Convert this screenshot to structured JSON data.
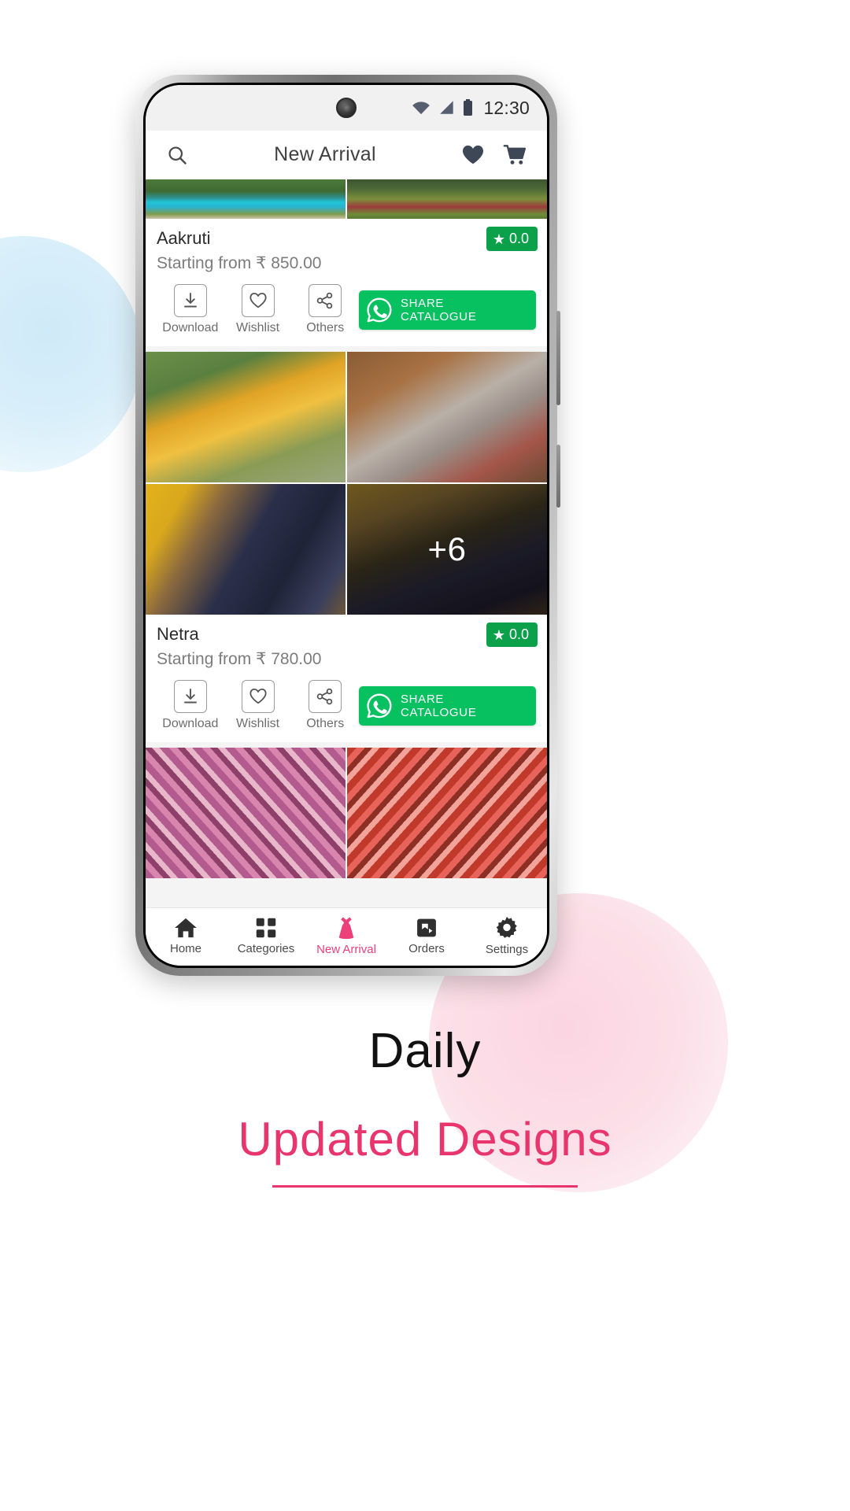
{
  "status_bar": {
    "time": "12:30",
    "icons": [
      "wifi-icon",
      "signal-icon",
      "battery-icon"
    ]
  },
  "app_bar": {
    "title": "New Arrival",
    "search_icon": "search-icon",
    "wishlist_icon": "heart-icon",
    "cart_icon": "cart-icon"
  },
  "products": [
    {
      "name": "Aakruti",
      "price": "Starting from ₹ 850.00",
      "rating": "0.0",
      "rating_star": "★",
      "extra_count": "",
      "actions": [
        {
          "label": "Download",
          "icon": "download-icon"
        },
        {
          "label": "Wishlist",
          "icon": "heart-outline-icon"
        },
        {
          "label": "Others",
          "icon": "share-nodes-icon"
        }
      ],
      "share_label": "SHARE CATALOGUE",
      "share_icon": "whatsapp-icon"
    },
    {
      "name": "Netra",
      "price": "Starting from ₹ 780.00",
      "rating": "0.0",
      "rating_star": "★",
      "extra_count": "+6",
      "actions": [
        {
          "label": "Download",
          "icon": "download-icon"
        },
        {
          "label": "Wishlist",
          "icon": "heart-outline-icon"
        },
        {
          "label": "Others",
          "icon": "share-nodes-icon"
        }
      ],
      "share_label": "SHARE CATALOGUE",
      "share_icon": "whatsapp-icon"
    }
  ],
  "bottom_nav": {
    "items": [
      {
        "label": "Home",
        "icon": "home-icon",
        "active": false
      },
      {
        "label": "Categories",
        "icon": "grid-icon",
        "active": false
      },
      {
        "label": "New Arrival",
        "icon": "dress-icon",
        "active": true
      },
      {
        "label": "Orders",
        "icon": "box-icon",
        "active": false
      },
      {
        "label": "Settings",
        "icon": "gear-icon",
        "active": false
      }
    ],
    "active_color": "#ec407a"
  },
  "caption": {
    "line1": "Daily",
    "line2": "Updated Designs",
    "line2_color": "#e8356d"
  },
  "theme": {
    "whatsapp_green": "#07c160",
    "rating_green": "#0aa14a",
    "accent_pink": "#e8356d"
  }
}
